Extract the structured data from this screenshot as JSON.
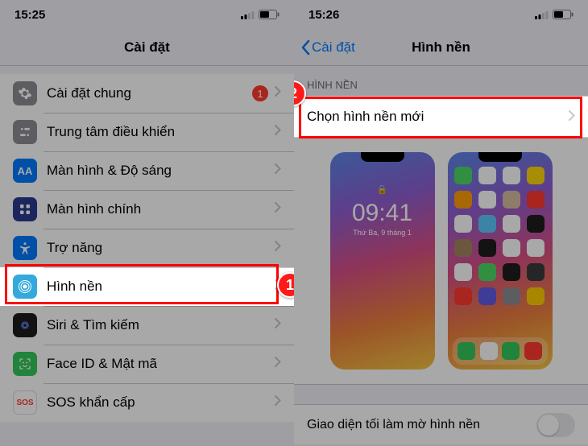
{
  "left": {
    "status": {
      "time": "15:25"
    },
    "title": "Cài đặt",
    "rows": {
      "general": {
        "label": "Cài đặt chung",
        "badge": "1"
      },
      "control": {
        "label": "Trung tâm điều khiển"
      },
      "display": {
        "label": "Màn hình & Độ sáng"
      },
      "home": {
        "label": "Màn hình chính"
      },
      "access": {
        "label": "Trợ năng"
      },
      "wall": {
        "label": "Hình nền"
      },
      "siri": {
        "label": "Siri & Tìm kiếm"
      },
      "face": {
        "label": "Face ID & Mật mã"
      },
      "sos": {
        "label": "SOS khẩn cấp"
      }
    },
    "callout": "1"
  },
  "right": {
    "status": {
      "time": "15:26"
    },
    "back": "Cài đặt",
    "title": "Hình nền",
    "section": "HÌNH NỀN",
    "choose": "Chọn hình nền mới",
    "lock_preview": {
      "time": "09:41",
      "date": "Thứ Ba, 9 tháng 1"
    },
    "dark_row": "Giao diện tối làm mờ hình nền",
    "callout": "2"
  },
  "icons": {
    "aa": "AA",
    "sos": "SOS"
  }
}
